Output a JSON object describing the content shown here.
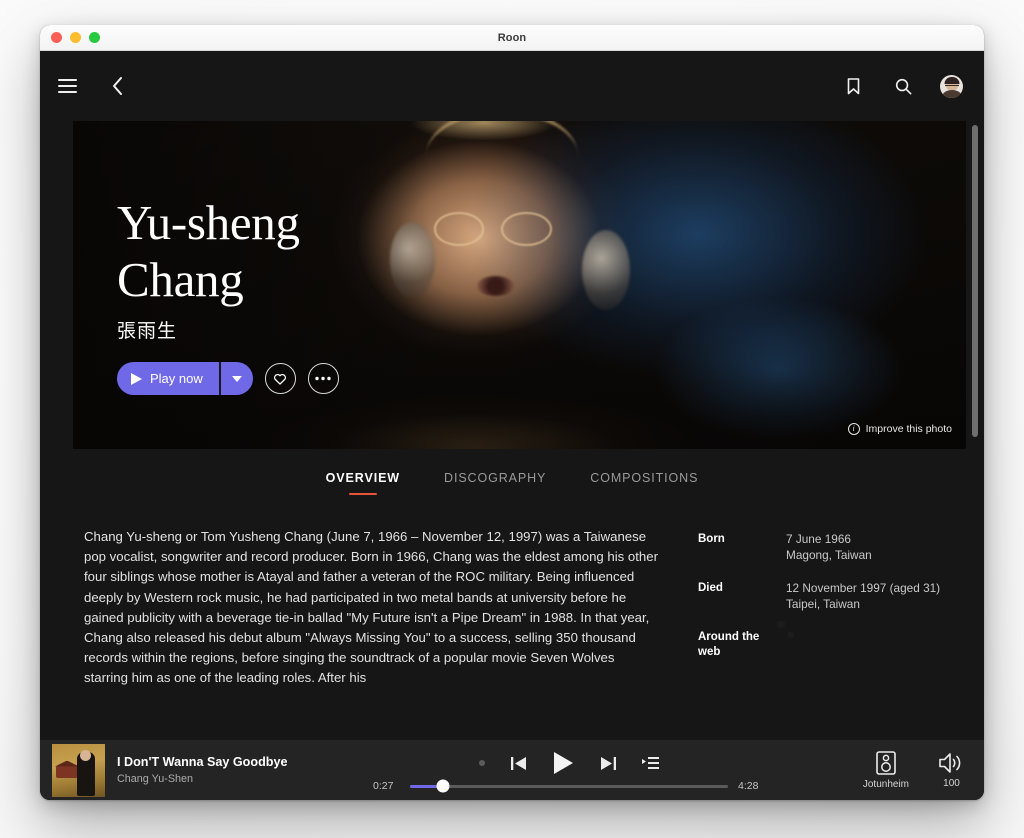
{
  "window": {
    "title": "Roon",
    "traffic_lights": [
      "close-button",
      "minimize-button",
      "zoom-button"
    ]
  },
  "topbar": {
    "menu_icon": "hamburger-menu-icon",
    "back_icon": "chevron-left-icon",
    "bookmark_icon": "bookmark-icon",
    "search_icon": "search-icon",
    "avatar": "user-avatar"
  },
  "hero": {
    "artist_name_line1": "Yu-sheng",
    "artist_name_line2": "Chang",
    "artist_name_native": "張雨生",
    "play_label": "Play now",
    "play_icon": "play-icon",
    "caret_icon": "chevron-down-icon",
    "favorite_icon": "heart-icon",
    "more_icon": "ellipsis-icon",
    "improve_photo_label": "Improve this photo",
    "improve_photo_icon": "info-icon"
  },
  "tabs": [
    {
      "label": "OVERVIEW",
      "active": true
    },
    {
      "label": "DISCOGRAPHY",
      "active": false
    },
    {
      "label": "COMPOSITIONS",
      "active": false
    }
  ],
  "overview": {
    "biography": "Chang Yu-sheng or Tom Yusheng Chang (June 7, 1966 – November 12, 1997) was a Taiwanese pop vocalist, songwriter and record producer. Born in 1966, Chang was the eldest among his other four siblings whose mother is Atayal and father a veteran of the ROC military. Being influenced deeply by Western rock music, he had participated in two metal bands at university before he gained publicity with a beverage tie-in ballad \"My Future isn't a Pipe Dream\" in 1988. In that year, Chang also released his debut album \"Always Missing You\" to a success, selling 350 thousand records within the regions, before singing the soundtrack of a popular movie Seven Wolves starring him as one of the leading roles. After his",
    "info": [
      {
        "label": "Born",
        "value_line1": "7 June 1966",
        "value_line2": "Magong, Taiwan"
      },
      {
        "label": "Died",
        "value_line1": "12 November 1997 (aged 31)",
        "value_line2": "Taipei, Taiwan"
      }
    ],
    "around_the_web_label": "Around the web",
    "around_the_web_icon": "globe-icon"
  },
  "player": {
    "track_title": "I Don'T Wanna Say Goodbye",
    "track_artist": "Chang Yu-Shen",
    "album_art": "album-artwork",
    "shuffle_icon": "shuffle-dot-icon",
    "previous_icon": "previous-track-icon",
    "play_icon": "play-icon",
    "next_icon": "next-track-icon",
    "queue_icon": "queue-icon",
    "elapsed": "0:27",
    "duration": "4:28",
    "progress_percent": 10.5,
    "zone_name": "Jotunheim",
    "zone_icon": "speaker-icon",
    "volume_value": "100",
    "volume_icon": "volume-icon"
  },
  "colors": {
    "accent_purple": "#6f69e8",
    "tab_underline": "#e8543a",
    "window_bg": "#161616",
    "player_bg": "#242424"
  },
  "scrollbar": {
    "name": "vertical-scrollbar"
  }
}
